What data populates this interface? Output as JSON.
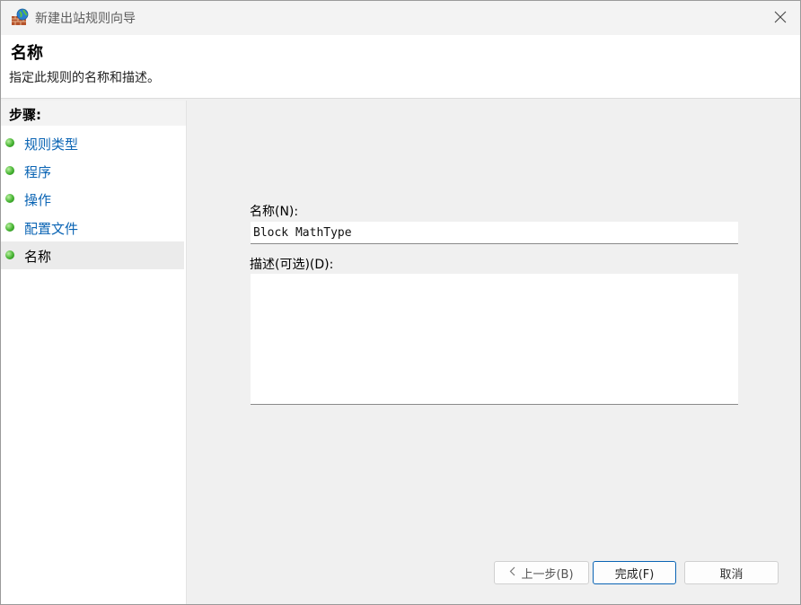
{
  "window": {
    "title": "新建出站规则向导"
  },
  "header": {
    "title": "名称",
    "description": "指定此规则的名称和描述。"
  },
  "steps": {
    "title": "步骤:",
    "items": [
      {
        "label": "规则类型"
      },
      {
        "label": "程序"
      },
      {
        "label": "操作"
      },
      {
        "label": "配置文件"
      },
      {
        "label": "名称"
      }
    ]
  },
  "form": {
    "name_label": "名称(N):",
    "name_value": "Block MathType",
    "description_label": "描述(可选)(D):",
    "description_value": ""
  },
  "buttons": {
    "back_label": "上一步(B)",
    "finish_label": "完成(F)",
    "cancel_label": "取消"
  },
  "colors": {
    "accent": "#0a64b4",
    "step_dot": "#46b332"
  }
}
